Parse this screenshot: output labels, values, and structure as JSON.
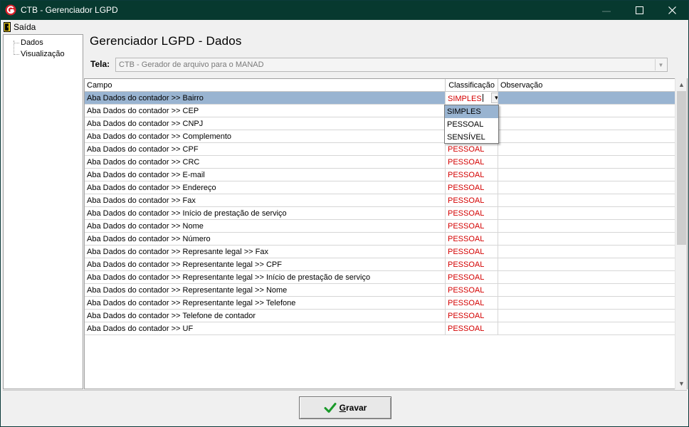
{
  "window": {
    "title": "CTB - Gerenciador LGPD",
    "minimize_glyph": "—",
    "maximize_glyph": "☐",
    "close_glyph": "✕"
  },
  "menu": {
    "items": [
      {
        "label": "Saída",
        "icon": "exit-door-icon"
      }
    ]
  },
  "tree": {
    "items": [
      {
        "label": "Dados"
      },
      {
        "label": "Visualização"
      }
    ]
  },
  "main": {
    "title": "Gerenciador LGPD - Dados",
    "tela_label": "Tela:",
    "tela_value": "CTB - Gerador de arquivo para o MANAD"
  },
  "grid": {
    "columns": [
      "Campo",
      "Classificação",
      "Observação"
    ],
    "rows": [
      {
        "campo": "Aba Dados do contador >> Bairro",
        "classificacao": "SIMPLES",
        "observacao": ""
      },
      {
        "campo": "Aba Dados do contador >> CEP",
        "classificacao": "",
        "observacao": ""
      },
      {
        "campo": "Aba Dados do contador >> CNPJ",
        "classificacao": "",
        "observacao": ""
      },
      {
        "campo": "Aba Dados do contador >> Complemento",
        "classificacao": "",
        "observacao": ""
      },
      {
        "campo": "Aba Dados do contador >> CPF",
        "classificacao": "PESSOAL",
        "observacao": ""
      },
      {
        "campo": "Aba Dados do contador >> CRC",
        "classificacao": "PESSOAL",
        "observacao": ""
      },
      {
        "campo": "Aba Dados do contador >> E-mail",
        "classificacao": "PESSOAL",
        "observacao": ""
      },
      {
        "campo": "Aba Dados do contador >> Endereço",
        "classificacao": "PESSOAL",
        "observacao": ""
      },
      {
        "campo": "Aba Dados do contador >> Fax",
        "classificacao": "PESSOAL",
        "observacao": ""
      },
      {
        "campo": "Aba Dados do contador >> Início de prestação de serviço",
        "classificacao": "PESSOAL",
        "observacao": ""
      },
      {
        "campo": "Aba Dados do contador >> Nome",
        "classificacao": "PESSOAL",
        "observacao": ""
      },
      {
        "campo": "Aba Dados do contador >> Número",
        "classificacao": "PESSOAL",
        "observacao": ""
      },
      {
        "campo": "Aba Dados do contador >> Represante legal >> Fax",
        "classificacao": "PESSOAL",
        "observacao": ""
      },
      {
        "campo": "Aba Dados do contador >> Representante legal >> CPF",
        "classificacao": "PESSOAL",
        "observacao": ""
      },
      {
        "campo": "Aba Dados do contador >> Representante legal >> Início de prestação de serviço",
        "classificacao": "PESSOAL",
        "observacao": ""
      },
      {
        "campo": "Aba Dados do contador >> Representante legal >> Nome",
        "classificacao": "PESSOAL",
        "observacao": ""
      },
      {
        "campo": "Aba Dados do contador >> Representante legal >> Telefone",
        "classificacao": "PESSOAL",
        "observacao": ""
      },
      {
        "campo": "Aba Dados do contador >> Telefone de contador",
        "classificacao": "PESSOAL",
        "observacao": ""
      },
      {
        "campo": "Aba Dados do contador >> UF",
        "classificacao": "PESSOAL",
        "observacao": ""
      }
    ],
    "dropdown_options": [
      "SIMPLES",
      "PESSOAL",
      "SENSÍVEL"
    ],
    "dropdown_highlighted": "SIMPLES"
  },
  "footer": {
    "save_label_underlined": "G",
    "save_label_rest": "ravar"
  },
  "colors": {
    "titlebar": "#07392f",
    "selection": "#99b4d1",
    "classification_text": "#d40000",
    "save_check": "#1a9a2a"
  }
}
